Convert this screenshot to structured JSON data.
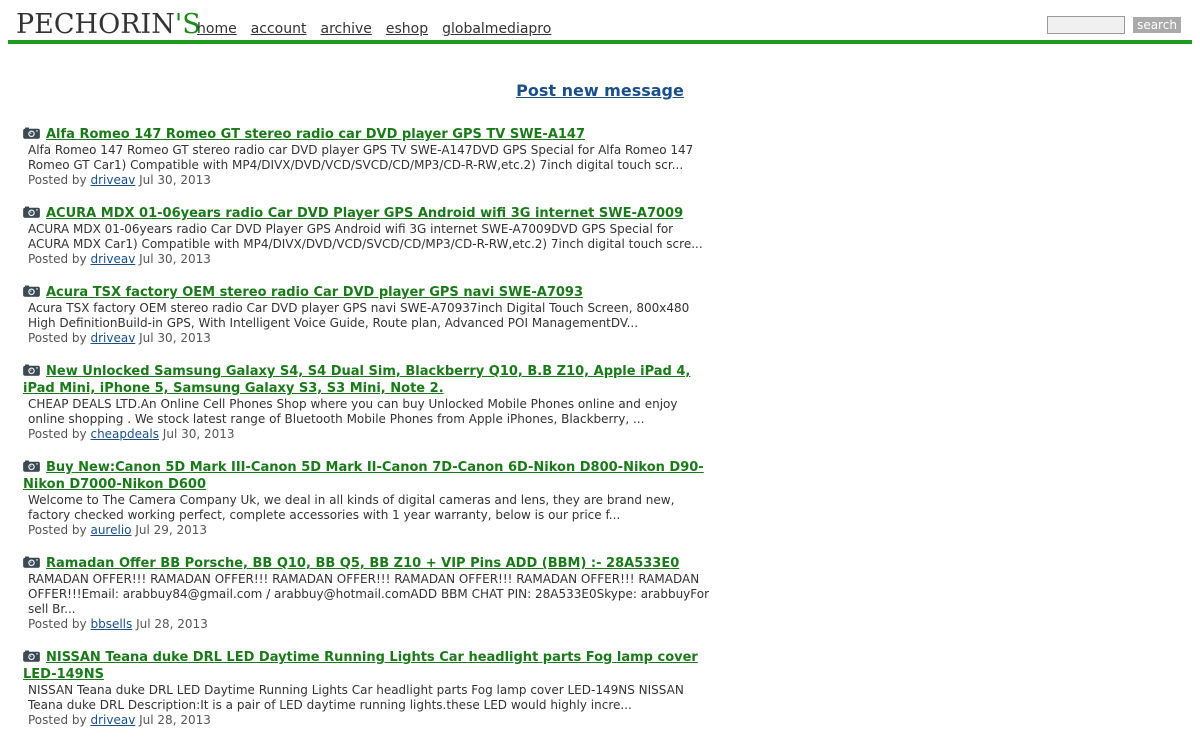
{
  "site": {
    "logo_main": "PECHORIN",
    "logo_accent": "'S"
  },
  "nav": {
    "items": [
      "home",
      "account",
      "archive",
      "eshop",
      "globalmediapro"
    ]
  },
  "search": {
    "input_value": "",
    "button_label": "search"
  },
  "post_new_label": "Post new message",
  "icon_names": {
    "item_icon": "camera-icon"
  },
  "posted_by_prefix": "Posted by",
  "listings": [
    {
      "title": "Alfa Romeo 147 Romeo GT stereo radio car DVD player GPS TV SWE-A147",
      "description": "Alfa Romeo 147 Romeo GT stereo radio car DVD player GPS TV SWE-A147DVD GPS Special for Alfa Romeo 147 Romeo GT Car1) Compatible with MP4/DIVX/DVD/VCD/SVCD/CD/MP3/CD-R-RW,etc.2) 7inch digital touch scr...",
      "author": "driveav",
      "date": "Jul 30, 2013"
    },
    {
      "title": "ACURA MDX 01-06years radio Car DVD Player GPS Android wifi 3G internet SWE-A7009",
      "description": "ACURA MDX 01-06years radio Car DVD Player GPS Android wifi 3G internet SWE-A7009DVD GPS Special for ACURA MDX Car1) Compatible with MP4/DIVX/DVD/VCD/SVCD/CD/MP3/CD-R-RW,etc.2) 7inch digital touch scre...",
      "author": "driveav",
      "date": "Jul 30, 2013"
    },
    {
      "title": "Acura TSX factory OEM stereo radio Car DVD player GPS navi SWE-A7093",
      "description": "Acura TSX factory OEM stereo radio Car DVD player GPS navi SWE-A70937inch Digital Touch Screen, 800x480 High DefinitionBuild-in GPS, With Intelligent Voice Guide, Route plan, Advanced POI ManagementDV...",
      "author": "driveav",
      "date": "Jul 30, 2013"
    },
    {
      "title": "New Unlocked Samsung Galaxy S4, S4 Dual Sim, Blackberry Q10, B.B Z10, Apple iPad 4, iPad Mini, iPhone 5, Samsung Galaxy S3, S3 Mini, Note 2.",
      "description": "CHEAP DEALS LTD.An Online Cell Phones Shop where you can buy Unlocked Mobile Phones online and enjoy online shopping . We stock latest range of Bluetooth Mobile Phones from Apple iPhones, Blackberry, ...",
      "author": "cheapdeals",
      "date": "Jul 30, 2013"
    },
    {
      "title": "Buy New:Canon 5D Mark III-Canon 5D Mark II-Canon 7D-Canon 6D-Nikon D800-Nikon D90-Nikon D7000-Nikon D600",
      "description": "Welcome to The Camera Company Uk, we deal in all kinds of digital cameras and lens, they are brand new, factory checked working perfect, complete accessories with 1 year warranty, below is our price f...",
      "author": "aurelio",
      "date": "Jul 29, 2013"
    },
    {
      "title": "Ramadan Offer BB Porsche, BB Q10, BB Q5, BB Z10 + VIP Pins ADD (BBM) :- 28A533E0",
      "description": "RAMADAN OFFER!!! RAMADAN OFFER!!! RAMADAN OFFER!!! RAMADAN OFFER!!! RAMADAN OFFER!!! RAMADAN OFFER!!!Email: arabbuy84@gmail.com / arabbuy@hotmail.comADD BBM CHAT PIN: 28A533E0Skype: arabbuyFor sell Br...",
      "author": "bbsells",
      "date": "Jul 28, 2013"
    },
    {
      "title": "NISSAN Teana duke DRL LED Daytime Running Lights Car headlight parts Fog lamp cover LED-149NS",
      "description": "NISSAN Teana duke DRL LED Daytime Running Lights Car headlight parts Fog lamp cover LED-149NS NISSAN Teana duke DRL Description:It is a pair of LED daytime running lights.these LED would highly incre...",
      "author": "driveav",
      "date": "Jul 28, 2013"
    }
  ]
}
